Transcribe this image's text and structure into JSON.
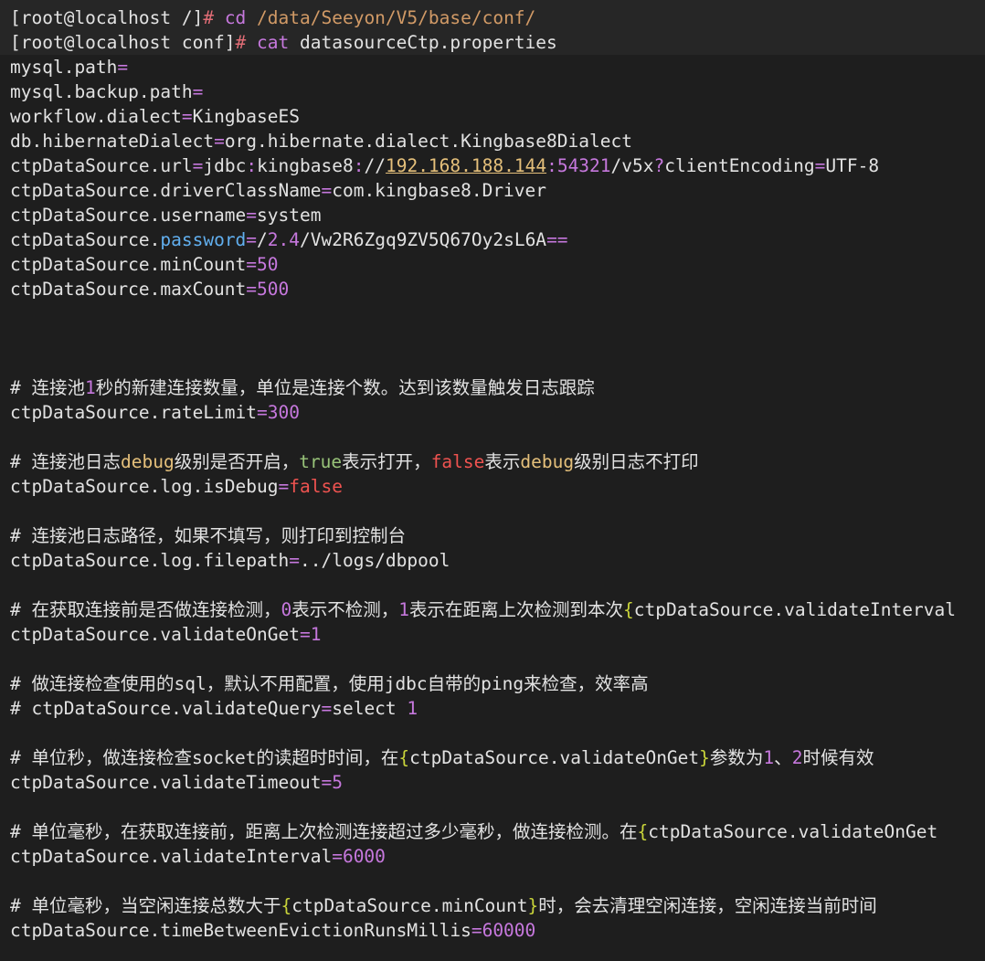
{
  "terminal": {
    "colors": {
      "background": "#1e1e1e",
      "default_text": "#e2e2e2",
      "prompt_symbol": "#e06c75",
      "command": "#c678dd",
      "path": "#d19a66",
      "equals": "#c678dd",
      "value": "#e2e2e2",
      "number": "#c678dd",
      "ip": "#e5c07b",
      "keyword_true": "#98c379",
      "keyword_false": "#ef5350",
      "debug_word": "#e5c07b",
      "password_key": "#61afef",
      "comment": "#e2e2e2",
      "brace": "#c9d43a"
    },
    "lines": [
      {
        "segments": [
          {
            "text": "[root@localhost /]",
            "color": "default_text"
          },
          {
            "text": "# ",
            "color": "prompt_symbol"
          },
          {
            "text": "cd ",
            "color": "command"
          },
          {
            "text": "/data/Seeyon/V5/base/conf/",
            "color": "path"
          }
        ]
      },
      {
        "segments": [
          {
            "text": "[root@localhost conf]",
            "color": "default_text"
          },
          {
            "text": "# ",
            "color": "prompt_symbol"
          },
          {
            "text": "cat ",
            "color": "command"
          },
          {
            "text": "datasourceCtp.properties",
            "color": "default_text"
          }
        ]
      },
      {
        "segments": [
          {
            "text": "mysql.path",
            "color": "default_text"
          },
          {
            "text": "=",
            "color": "equals"
          }
        ]
      },
      {
        "segments": [
          {
            "text": "mysql.backup.path",
            "color": "default_text"
          },
          {
            "text": "=",
            "color": "equals"
          }
        ]
      },
      {
        "segments": [
          {
            "text": "workflow.dialect",
            "color": "default_text"
          },
          {
            "text": "=",
            "color": "equals"
          },
          {
            "text": "KingbaseES",
            "color": "value"
          }
        ]
      },
      {
        "segments": [
          {
            "text": "db.hibernateDialect",
            "color": "default_text"
          },
          {
            "text": "=",
            "color": "equals"
          },
          {
            "text": "org.hibernate.dialect.Kingbase8Dialect",
            "color": "value"
          }
        ]
      },
      {
        "segments": [
          {
            "text": "ctpDataSource.url",
            "color": "default_text"
          },
          {
            "text": "=",
            "color": "equals"
          },
          {
            "text": "jdbc",
            "color": "value"
          },
          {
            "text": ":",
            "color": "equals"
          },
          {
            "text": "kingbase8",
            "color": "value"
          },
          {
            "text": ":",
            "color": "equals"
          },
          {
            "text": "//",
            "color": "value"
          },
          {
            "text": "192.168.188.144",
            "color": "ip"
          },
          {
            "text": ":",
            "color": "equals"
          },
          {
            "text": "54321",
            "color": "number"
          },
          {
            "text": "/v5x",
            "color": "value"
          },
          {
            "text": "?",
            "color": "equals"
          },
          {
            "text": "clientEncoding",
            "color": "value"
          },
          {
            "text": "=",
            "color": "equals"
          },
          {
            "text": "UTF-8",
            "color": "value"
          }
        ]
      },
      {
        "segments": [
          {
            "text": "ctpDataSource.driverClassName",
            "color": "default_text"
          },
          {
            "text": "=",
            "color": "equals"
          },
          {
            "text": "com.kingbase8.Driver",
            "color": "value"
          }
        ]
      },
      {
        "segments": [
          {
            "text": "ctpDataSource.username",
            "color": "default_text"
          },
          {
            "text": "=",
            "color": "equals"
          },
          {
            "text": "system",
            "color": "value"
          }
        ]
      },
      {
        "segments": [
          {
            "text": "ctpDataSource.",
            "color": "default_text"
          },
          {
            "text": "password",
            "color": "password_key"
          },
          {
            "text": "=",
            "color": "equals"
          },
          {
            "text": "/",
            "color": "value"
          },
          {
            "text": "2.4",
            "color": "number"
          },
          {
            "text": "/Vw2R6Zgq9ZV5Q67Oy2sL6A",
            "color": "value"
          },
          {
            "text": "==",
            "color": "equals"
          }
        ]
      },
      {
        "segments": [
          {
            "text": "ctpDataSource.minCount",
            "color": "default_text"
          },
          {
            "text": "=",
            "color": "equals"
          },
          {
            "text": "50",
            "color": "number"
          }
        ]
      },
      {
        "segments": [
          {
            "text": "ctpDataSource.maxCount",
            "color": "default_text"
          },
          {
            "text": "=",
            "color": "equals"
          },
          {
            "text": "500",
            "color": "number"
          }
        ]
      },
      {
        "segments": []
      },
      {
        "segments": []
      },
      {
        "segments": []
      },
      {
        "segments": [
          {
            "text": "# 连接池",
            "color": "comment"
          },
          {
            "text": "1",
            "color": "number"
          },
          {
            "text": "秒的新建连接数量，单位是连接个数。达到该数量触发日志跟踪",
            "color": "comment"
          }
        ]
      },
      {
        "segments": [
          {
            "text": "ctpDataSource.rateLimit",
            "color": "default_text"
          },
          {
            "text": "=",
            "color": "equals"
          },
          {
            "text": "300",
            "color": "number"
          }
        ]
      },
      {
        "segments": []
      },
      {
        "segments": [
          {
            "text": "# 连接池日志",
            "color": "comment"
          },
          {
            "text": "debug",
            "color": "debug_word"
          },
          {
            "text": "级别是否开启，",
            "color": "comment"
          },
          {
            "text": "true",
            "color": "keyword_true"
          },
          {
            "text": "表示打开，",
            "color": "comment"
          },
          {
            "text": "false",
            "color": "keyword_false"
          },
          {
            "text": "表示",
            "color": "comment"
          },
          {
            "text": "debug",
            "color": "debug_word"
          },
          {
            "text": "级别日志不打印",
            "color": "comment"
          }
        ]
      },
      {
        "segments": [
          {
            "text": "ctpDataSource.log.isDebug",
            "color": "default_text"
          },
          {
            "text": "=",
            "color": "equals"
          },
          {
            "text": "false",
            "color": "keyword_false"
          }
        ]
      },
      {
        "segments": []
      },
      {
        "segments": [
          {
            "text": "# 连接池日志路径，如果不填写，则打印到控制台",
            "color": "comment"
          }
        ]
      },
      {
        "segments": [
          {
            "text": "ctpDataSource.log.filepath",
            "color": "default_text"
          },
          {
            "text": "=",
            "color": "equals"
          },
          {
            "text": "../logs/dbpool",
            "color": "value"
          }
        ]
      },
      {
        "segments": []
      },
      {
        "segments": [
          {
            "text": "# 在获取连接前是否做连接检测，",
            "color": "comment"
          },
          {
            "text": "0",
            "color": "number"
          },
          {
            "text": "表示不检测，",
            "color": "comment"
          },
          {
            "text": "1",
            "color": "number"
          },
          {
            "text": "表示在距离上次检测到本次",
            "color": "comment"
          },
          {
            "text": "{",
            "color": "brace"
          },
          {
            "text": "ctpDataSource.validateInterval",
            "color": "comment"
          }
        ]
      },
      {
        "segments": [
          {
            "text": "ctpDataSource.validateOnGet",
            "color": "default_text"
          },
          {
            "text": "=",
            "color": "equals"
          },
          {
            "text": "1",
            "color": "number"
          }
        ]
      },
      {
        "segments": []
      },
      {
        "segments": [
          {
            "text": "# 做连接检查使用的sql，默认不用配置，使用jdbc自带的ping来检查，效率高",
            "color": "comment"
          }
        ]
      },
      {
        "segments": [
          {
            "text": "# ctpDataSource.validateQuery",
            "color": "comment"
          },
          {
            "text": "=",
            "color": "equals"
          },
          {
            "text": "select ",
            "color": "comment"
          },
          {
            "text": "1",
            "color": "number"
          }
        ]
      },
      {
        "segments": []
      },
      {
        "segments": [
          {
            "text": "# 单位秒，做连接检查socket的读超时时间，在",
            "color": "comment"
          },
          {
            "text": "{",
            "color": "brace"
          },
          {
            "text": "ctpDataSource.validateOnGet",
            "color": "comment"
          },
          {
            "text": "}",
            "color": "brace"
          },
          {
            "text": "参数为",
            "color": "comment"
          },
          {
            "text": "1",
            "color": "number"
          },
          {
            "text": "、",
            "color": "comment"
          },
          {
            "text": "2",
            "color": "number"
          },
          {
            "text": "时候有效",
            "color": "comment"
          }
        ]
      },
      {
        "segments": [
          {
            "text": "ctpDataSource.validateTimeout",
            "color": "default_text"
          },
          {
            "text": "=",
            "color": "equals"
          },
          {
            "text": "5",
            "color": "number"
          }
        ]
      },
      {
        "segments": []
      },
      {
        "segments": [
          {
            "text": "# 单位毫秒，在获取连接前，距离上次检测连接超过多少毫秒，做连接检测。在",
            "color": "comment"
          },
          {
            "text": "{",
            "color": "brace"
          },
          {
            "text": "ctpDataSource.validateOnGet",
            "color": "comment"
          }
        ]
      },
      {
        "segments": [
          {
            "text": "ctpDataSource.validateInterval",
            "color": "default_text"
          },
          {
            "text": "=",
            "color": "equals"
          },
          {
            "text": "6000",
            "color": "number"
          }
        ]
      },
      {
        "segments": []
      },
      {
        "segments": [
          {
            "text": "# 单位毫秒，当空闲连接总数大于",
            "color": "comment"
          },
          {
            "text": "{",
            "color": "brace"
          },
          {
            "text": "ctpDataSource.minCount",
            "color": "comment"
          },
          {
            "text": "}",
            "color": "brace"
          },
          {
            "text": "时，会去清理空闲连接，空闲连接当前时间",
            "color": "comment"
          }
        ]
      },
      {
        "segments": [
          {
            "text": "ctpDataSource.timeBetweenEvictionRunsMillis",
            "color": "default_text"
          },
          {
            "text": "=",
            "color": "equals"
          },
          {
            "text": "60000",
            "color": "number"
          }
        ]
      }
    ]
  }
}
